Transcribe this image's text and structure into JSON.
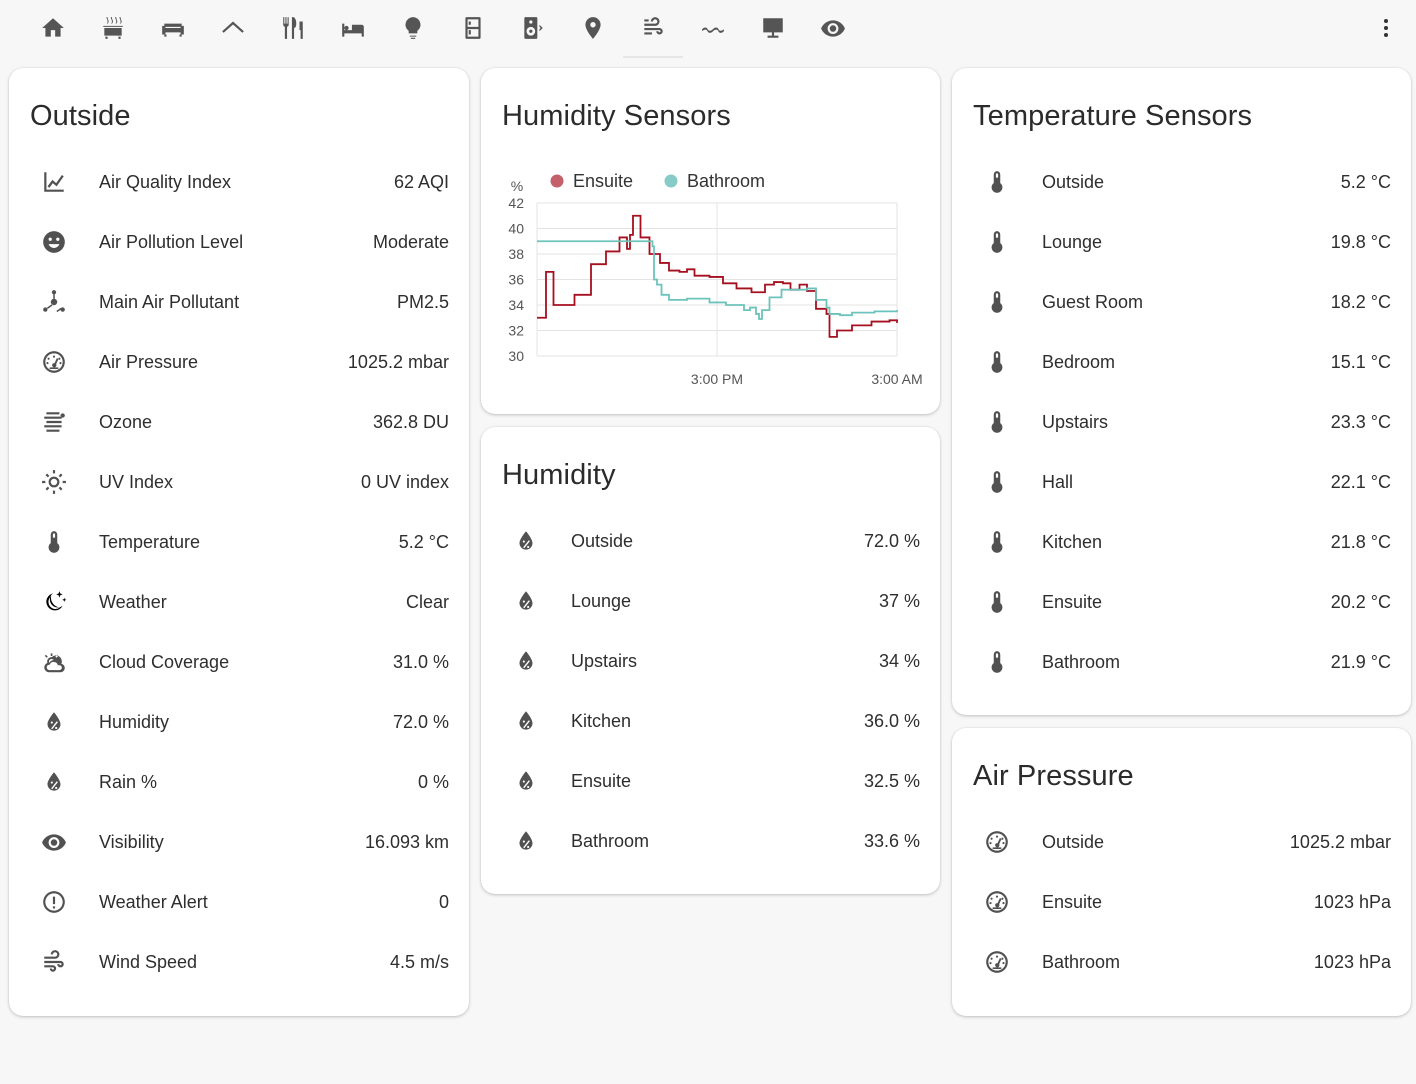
{
  "topbar": {
    "tabs": [
      "home-icon",
      "radiator-icon",
      "sofa-icon",
      "roof-icon",
      "silverware-icon",
      "bed-icon",
      "lightbulb-icon",
      "fridge-icon",
      "speaker-icon",
      "map-marker-icon",
      "weather-windy-icon",
      "waves-icon",
      "desktop-icon",
      "eye-icon"
    ],
    "active_tab": 10,
    "menu_icon": "dots-vertical-icon"
  },
  "outside": {
    "title": "Outside",
    "rows": [
      {
        "icon": "chart-line-icon",
        "label": "Air Quality Index",
        "value": "62 AQI"
      },
      {
        "icon": "emoticon-icon",
        "label": "Air Pollution Level",
        "value": "Moderate"
      },
      {
        "icon": "molecule-icon",
        "label": "Main Air Pollutant",
        "value": "PM2.5"
      },
      {
        "icon": "gauge-icon",
        "label": "Air Pressure",
        "value": "1025.2 mbar"
      },
      {
        "icon": "ozone-icon",
        "label": "Ozone",
        "value": "362.8 DU"
      },
      {
        "icon": "sun-icon",
        "label": "UV Index",
        "value": "0 UV index"
      },
      {
        "icon": "thermometer-icon",
        "label": "Temperature",
        "value": "5.2 °C"
      },
      {
        "icon": "weather-night-icon",
        "label": "Weather",
        "value": "Clear"
      },
      {
        "icon": "cloud-sun-icon",
        "label": "Cloud Coverage",
        "value": "31.0 %"
      },
      {
        "icon": "water-percent-icon",
        "label": "Humidity",
        "value": "72.0 %"
      },
      {
        "icon": "water-percent-icon",
        "label": "Rain %",
        "value": "0 %"
      },
      {
        "icon": "eye-icon",
        "label": "Visibility",
        "value": "16.093 km"
      },
      {
        "icon": "alert-circle-icon",
        "label": "Weather Alert",
        "value": "0"
      },
      {
        "icon": "wind-icon",
        "label": "Wind Speed",
        "value": "4.5 m/s"
      }
    ]
  },
  "humidity_sensors": {
    "title": "Humidity Sensors"
  },
  "humidity": {
    "title": "Humidity",
    "rows": [
      {
        "icon": "water-percent-icon",
        "label": "Outside",
        "value": "72.0 %"
      },
      {
        "icon": "water-percent-icon",
        "label": "Lounge",
        "value": "37 %"
      },
      {
        "icon": "water-percent-icon",
        "label": "Upstairs",
        "value": "34 %"
      },
      {
        "icon": "water-percent-icon",
        "label": "Kitchen",
        "value": "36.0 %"
      },
      {
        "icon": "water-percent-icon",
        "label": "Ensuite",
        "value": "32.5 %"
      },
      {
        "icon": "water-percent-icon",
        "label": "Bathroom",
        "value": "33.6 %"
      }
    ]
  },
  "temperature": {
    "title": "Temperature Sensors",
    "rows": [
      {
        "icon": "thermometer-icon",
        "label": "Outside",
        "value": "5.2 °C"
      },
      {
        "icon": "thermometer-icon",
        "label": "Lounge",
        "value": "19.8 °C"
      },
      {
        "icon": "thermometer-icon",
        "label": "Guest Room",
        "value": "18.2 °C"
      },
      {
        "icon": "thermometer-icon",
        "label": "Bedroom",
        "value": "15.1 °C"
      },
      {
        "icon": "thermometer-icon",
        "label": "Upstairs",
        "value": "23.3 °C"
      },
      {
        "icon": "thermometer-icon",
        "label": "Hall",
        "value": "22.1 °C"
      },
      {
        "icon": "thermometer-icon",
        "label": "Kitchen",
        "value": "21.8 °C"
      },
      {
        "icon": "thermometer-icon",
        "label": "Ensuite",
        "value": "20.2 °C"
      },
      {
        "icon": "thermometer-icon",
        "label": "Bathroom",
        "value": "21.9 °C"
      }
    ]
  },
  "air_pressure": {
    "title": "Air Pressure",
    "rows": [
      {
        "icon": "gauge-icon",
        "label": "Outside",
        "value": "1025.2 mbar"
      },
      {
        "icon": "gauge-icon",
        "label": "Ensuite",
        "value": "1023 hPa"
      },
      {
        "icon": "gauge-icon",
        "label": "Bathroom",
        "value": "1023 hPa"
      }
    ]
  },
  "chart_data": {
    "type": "line",
    "title": "",
    "xlabel": "",
    "ylabel": "%",
    "ylim": [
      30,
      42
    ],
    "yticks": [
      30,
      32,
      34,
      36,
      38,
      40,
      42
    ],
    "xlim": [
      0,
      24
    ],
    "xticks": [
      {
        "x": 12,
        "label": "3:00 PM"
      },
      {
        "x": 24,
        "label": "3:00 AM"
      }
    ],
    "grid": true,
    "legend_position": "top",
    "series": [
      {
        "name": "Ensuite",
        "color": "#a50f1e",
        "legend_color": "#c4606a",
        "step": true,
        "points": [
          [
            0,
            33
          ],
          [
            0.6,
            36.6
          ],
          [
            1.1,
            34
          ],
          [
            2.5,
            34.8
          ],
          [
            3.6,
            37.2
          ],
          [
            4.6,
            38.2
          ],
          [
            5.5,
            39.3
          ],
          [
            6.0,
            38.4
          ],
          [
            6.2,
            39.5
          ],
          [
            6.4,
            41
          ],
          [
            6.9,
            39.3
          ],
          [
            7.5,
            38
          ],
          [
            8.2,
            37.3
          ],
          [
            8.8,
            36.7
          ],
          [
            9.5,
            36.6
          ],
          [
            10.0,
            36.8
          ],
          [
            10.5,
            36.3
          ],
          [
            11.5,
            36.2
          ],
          [
            12.4,
            35.7
          ],
          [
            13.3,
            35.3
          ],
          [
            14.3,
            35.0
          ],
          [
            15.2,
            35.6
          ],
          [
            15.8,
            35.8
          ],
          [
            16.4,
            35.7
          ],
          [
            16.9,
            35.2
          ],
          [
            17.5,
            35.6
          ],
          [
            18.0,
            35.1
          ],
          [
            18.6,
            33.7
          ],
          [
            19.3,
            33.3
          ],
          [
            19.5,
            31.5
          ],
          [
            20.0,
            32.0
          ],
          [
            21.0,
            32.4
          ],
          [
            22.3,
            32.7
          ],
          [
            23.5,
            32.8
          ],
          [
            24,
            32.6
          ]
        ]
      },
      {
        "name": "Bathroom",
        "color": "#6cc3bb",
        "legend_color": "#86cbc7",
        "step": true,
        "points": [
          [
            0,
            39
          ],
          [
            5.8,
            39
          ],
          [
            7.7,
            38.6
          ],
          [
            7.8,
            36
          ],
          [
            8.0,
            35.6
          ],
          [
            8.3,
            34.8
          ],
          [
            8.8,
            34.4
          ],
          [
            10.0,
            34.5
          ],
          [
            11.5,
            34.2
          ],
          [
            12.6,
            34.0
          ],
          [
            13.8,
            33.6
          ],
          [
            14.2,
            33.8
          ],
          [
            14.6,
            33.3
          ],
          [
            14.8,
            32.9
          ],
          [
            15.0,
            33.6
          ],
          [
            15.5,
            34.6
          ],
          [
            16.3,
            35.2
          ],
          [
            18.0,
            35.3
          ],
          [
            18.6,
            34.4
          ],
          [
            19.3,
            33.8
          ],
          [
            19.5,
            33.3
          ],
          [
            20.2,
            33.2
          ],
          [
            21.0,
            33.4
          ],
          [
            22.5,
            33.5
          ],
          [
            24,
            33.6
          ]
        ]
      }
    ]
  }
}
